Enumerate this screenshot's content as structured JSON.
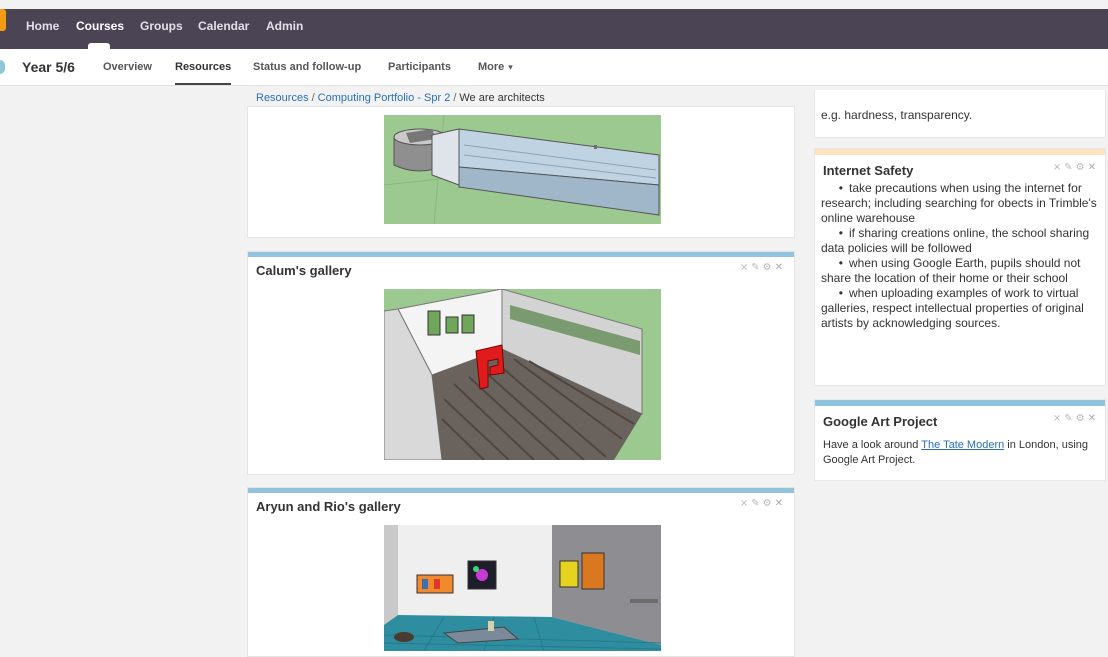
{
  "topnav": {
    "items": [
      {
        "label": "Home",
        "active": false
      },
      {
        "label": "Courses",
        "active": true
      },
      {
        "label": "Groups",
        "active": false
      },
      {
        "label": "Calendar",
        "active": false
      },
      {
        "label": "Admin",
        "active": false
      }
    ]
  },
  "subnav": {
    "course_title": "Year 5/6",
    "items": [
      {
        "label": "Overview",
        "active": false
      },
      {
        "label": "Resources",
        "active": true
      },
      {
        "label": "Status and follow-up",
        "active": false
      },
      {
        "label": "Participants",
        "active": false
      },
      {
        "label": "More",
        "active": false,
        "caret": "▾"
      }
    ]
  },
  "breadcrumb": {
    "crumbs": [
      "Resources",
      "Computing Portfolio - Spr 2",
      "We are architects"
    ],
    "separator": "/"
  },
  "main_cards": [
    {
      "title": "",
      "image": "sketchup-building-model"
    },
    {
      "title": "Calum's gallery",
      "image": "sketchup-gallery-red-sculpture"
    },
    {
      "title": "Aryun and Rio's gallery",
      "image": "sketchup-gallery-paintings"
    }
  ],
  "card_tools": {
    "collapse": "⨯",
    "edit": "✎",
    "settings": "⚙",
    "close": "✕"
  },
  "sidebar": {
    "top_text": "e.g. hardness, transparency.",
    "internet_safety": {
      "title": "Internet Safety",
      "bullets": [
        "take precautions when using the internet for research; including searching for obects in Trimble's online warehouse",
        "if sharing creations online, the school sharing data policies will be followed",
        "when using Google Earth, pupils should not share the location of their home or their school",
        "when uploading examples of work to virtual galleries, respect intellectual properties of original artists by acknowledging sources."
      ]
    },
    "google_art": {
      "title": "Google Art Project",
      "text_before": "Have a look around ",
      "link": "The Tate Modern",
      "text_after": " in London, using Google Art Project."
    }
  },
  "colors": {
    "topnav_bg": "#4b4455",
    "accent_blue": "#92c3dd",
    "accent_peach": "#fde3c0",
    "link": "#2a6ebb",
    "brand_orange": "#f39c12"
  }
}
